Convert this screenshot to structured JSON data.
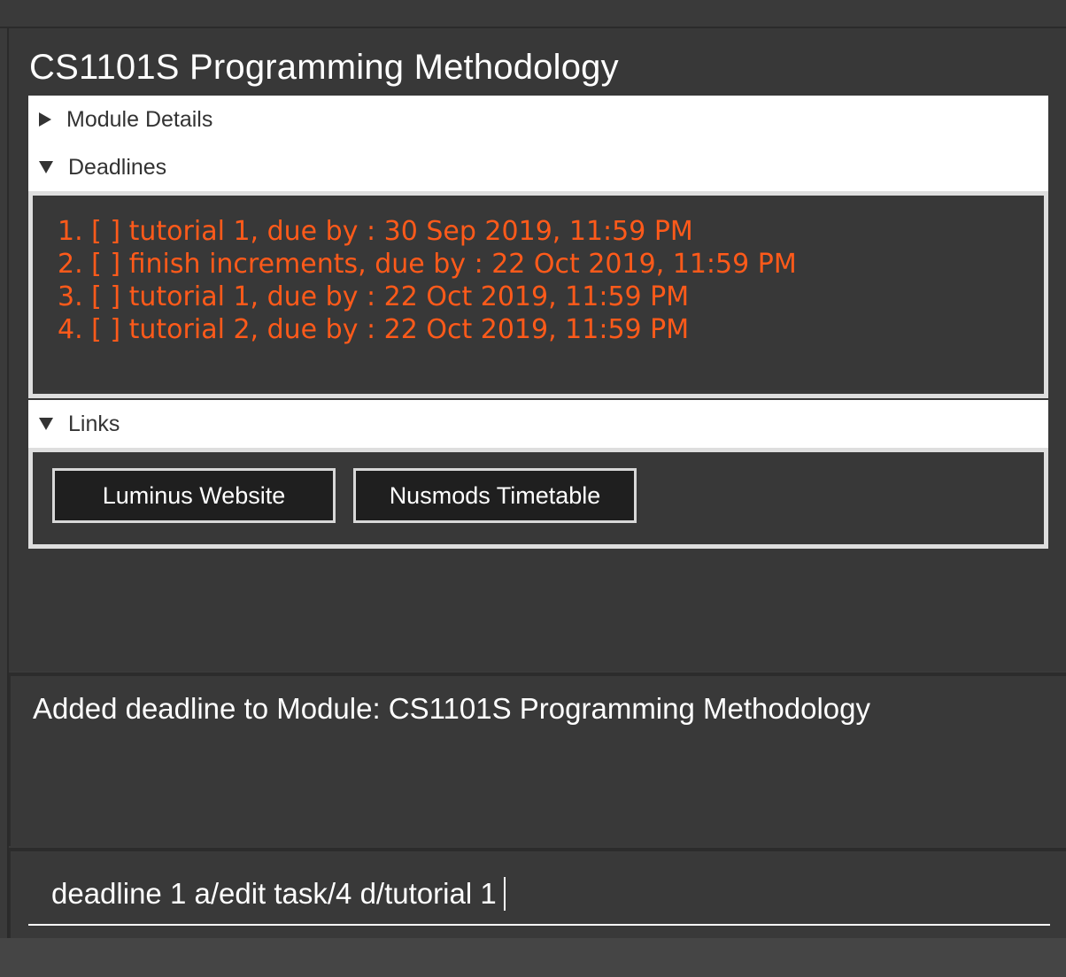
{
  "module": {
    "title": "CS1101S Programming Methodology"
  },
  "sections": {
    "details_label": "Module Details",
    "deadlines_label": "Deadlines",
    "links_label": "Links"
  },
  "deadlines": [
    "1. [ ] tutorial 1, due by : 30 Sep 2019, 11:59 PM",
    "2. [ ] finish increments, due by : 22 Oct 2019, 11:59 PM",
    "3. [ ] tutorial 1, due by : 22 Oct 2019, 11:59 PM",
    "4. [ ] tutorial 2, due by : 22 Oct 2019, 11:59 PM"
  ],
  "links": {
    "luminus_label": "Luminus Website",
    "nusmods_label": "Nusmods Timetable"
  },
  "result": {
    "message": "Added deadline to Module: CS1101S Programming Methodology"
  },
  "command": {
    "value": "deadline 1 a/edit task/4 d/tutorial 1"
  },
  "colors": {
    "deadline_text": "#ff5a1a",
    "background": "#383838"
  }
}
